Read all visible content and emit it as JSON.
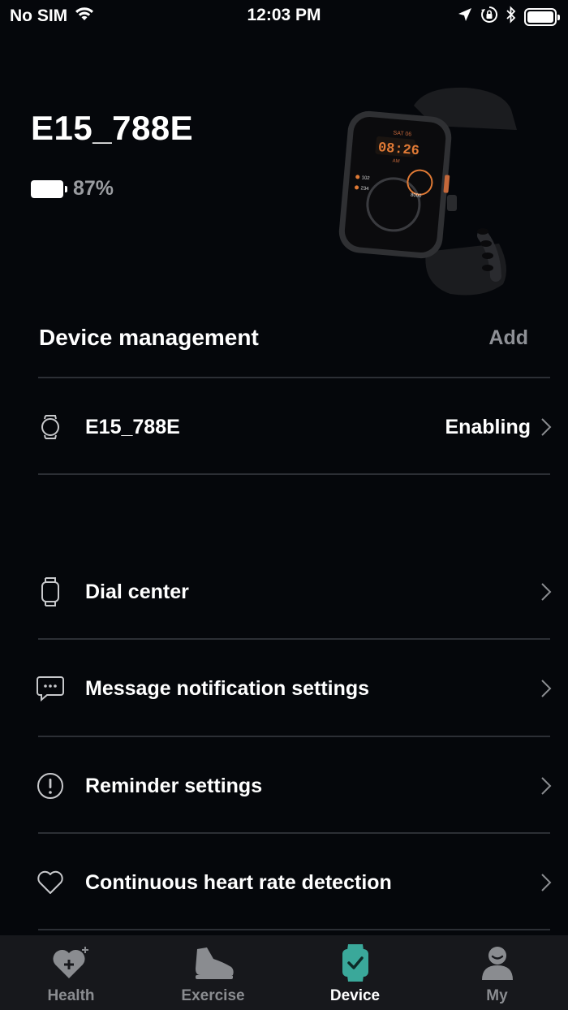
{
  "status_bar": {
    "carrier": "No SIM",
    "time": "12:03 PM"
  },
  "device": {
    "name": "E15_788E",
    "battery_text": "87%",
    "battery_level": 0.87
  },
  "device_management": {
    "title": "Device management",
    "add_label": "Add",
    "devices": [
      {
        "name": "E15_788E",
        "status": "Enabling",
        "icon": "watch-round-icon"
      }
    ]
  },
  "menu": [
    {
      "label": "Dial center",
      "icon": "watch-square-icon"
    },
    {
      "label": "Message notification settings",
      "icon": "message-bubble-icon"
    },
    {
      "label": "Reminder settings",
      "icon": "exclamation-circle-icon"
    },
    {
      "label": "Continuous heart rate detection",
      "icon": "heart-outline-icon"
    }
  ],
  "tabs": [
    {
      "label": "Health",
      "icon": "heart-plus-icon",
      "active": false
    },
    {
      "label": "Exercise",
      "icon": "shoe-icon",
      "active": false
    },
    {
      "label": "Device",
      "icon": "smartwatch-icon",
      "active": true
    },
    {
      "label": "My",
      "icon": "user-icon",
      "active": false
    }
  ],
  "colors": {
    "background": "#05070b",
    "accent": "#3aa89a",
    "muted_text": "#8e9096",
    "tab_bar": "#17181c"
  }
}
